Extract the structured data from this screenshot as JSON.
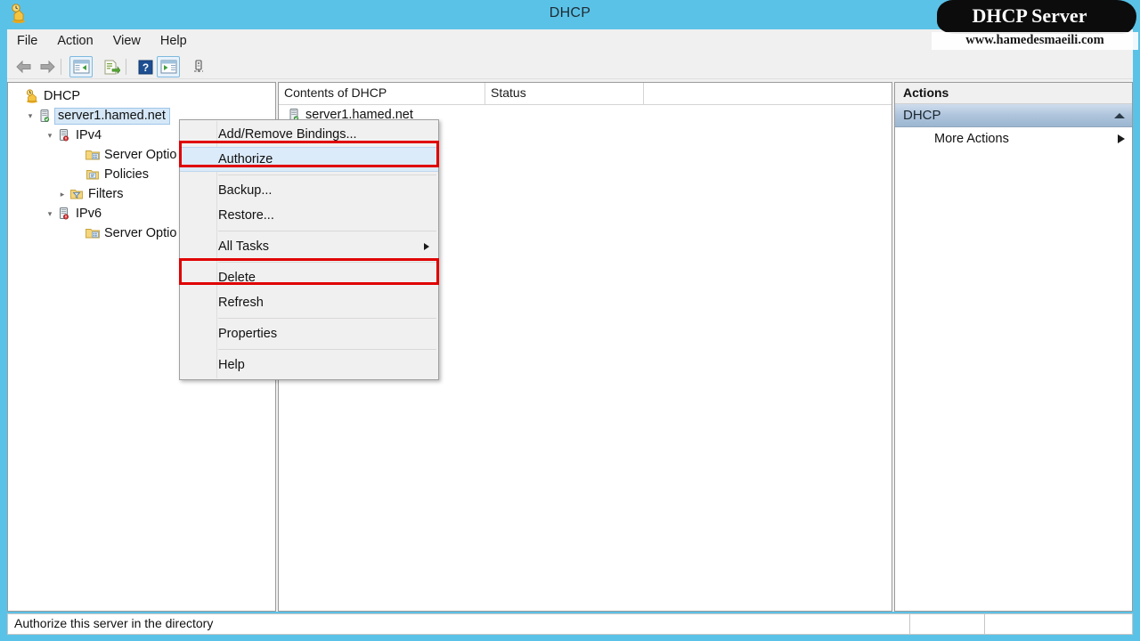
{
  "window": {
    "title": "DHCP",
    "app_icon": "dhcp-server-icon"
  },
  "menubar": {
    "items": [
      {
        "label": "File"
      },
      {
        "label": "Action"
      },
      {
        "label": "View"
      },
      {
        "label": "Help"
      }
    ]
  },
  "toolbar": {
    "buttons": [
      {
        "name": "back-icon"
      },
      {
        "name": "forward-icon"
      },
      {
        "name": "show-hide-console-tree-icon"
      },
      {
        "name": "export-list-icon"
      },
      {
        "name": "help-icon"
      },
      {
        "name": "show-hide-action-pane-icon"
      },
      {
        "name": "refresh-server-icon"
      }
    ]
  },
  "tree": {
    "nodes": [
      {
        "label": "DHCP",
        "icon": "dhcp-root-icon",
        "indent": 0,
        "twisty": "",
        "selected": false
      },
      {
        "label": "server1.hamed.net",
        "icon": "server-icon",
        "indent": 1,
        "twisty": "expanded",
        "selected": true
      },
      {
        "label": "IPv4",
        "icon": "ipv4-icon",
        "indent": 2,
        "twisty": "expanded",
        "selected": false
      },
      {
        "label": "Server Optio",
        "icon": "server-options-folder-icon",
        "indent": 3,
        "twisty": "",
        "selected": false
      },
      {
        "label": "Policies",
        "icon": "policies-folder-icon",
        "indent": 3,
        "twisty": "",
        "selected": false
      },
      {
        "label": "Filters",
        "icon": "filters-folder-icon",
        "indent": 2,
        "twisty": "collapsed",
        "selected": false
      },
      {
        "label": "IPv6",
        "icon": "ipv6-icon",
        "indent": 2,
        "twisty": "expanded",
        "selected": false
      },
      {
        "label": "Server Optio",
        "icon": "server-options-folder-icon",
        "indent": 3,
        "twisty": "",
        "selected": false
      }
    ]
  },
  "list": {
    "columns": [
      {
        "label": "Contents of DHCP"
      },
      {
        "label": "Status"
      },
      {
        "label": ""
      }
    ],
    "rows": [
      {
        "name": "server1.hamed.net",
        "status": "",
        "icon": "server-icon"
      }
    ]
  },
  "actions": {
    "title": "Actions",
    "group_label": "DHCP",
    "group_collapse_icon": "caret-up-icon",
    "items": [
      {
        "label": "More Actions",
        "submenu_icon": "caret-right-icon"
      }
    ]
  },
  "context_menu": {
    "items": [
      {
        "label": "Add/Remove Bindings...",
        "highlight": false,
        "submenu": false,
        "separator_after": false
      },
      {
        "label": "Authorize",
        "highlight": true,
        "submenu": false,
        "separator_after": true
      },
      {
        "label": "Backup...",
        "highlight": false,
        "submenu": false,
        "separator_after": false
      },
      {
        "label": "Restore...",
        "highlight": false,
        "submenu": false,
        "separator_after": true
      },
      {
        "label": "All Tasks",
        "highlight": false,
        "submenu": true,
        "separator_after": true
      },
      {
        "label": "Delete",
        "highlight": false,
        "submenu": false,
        "separator_after": false
      },
      {
        "label": "Refresh",
        "highlight": false,
        "submenu": false,
        "separator_after": true
      },
      {
        "label": "Properties",
        "highlight": false,
        "submenu": false,
        "separator_after": true
      },
      {
        "label": "Help",
        "highlight": false,
        "submenu": false,
        "separator_after": false
      }
    ]
  },
  "annotations": {
    "color": "#e00000",
    "boxes": [
      {
        "target": "authorize-menu-item"
      },
      {
        "target": "refresh-menu-item"
      }
    ]
  },
  "statusbar": {
    "message": "Authorize this server in the directory",
    "cells": [
      "",
      "",
      ""
    ]
  },
  "watermark": {
    "banner_text": "DHCP Server",
    "url": "www.hamedesmaeili.com"
  },
  "colors": {
    "desktop_blue": "#5bc2e7",
    "chrome_gray": "#f0f0f0",
    "selection_blue": "#d6e8f7",
    "annotation_red": "#e00000"
  }
}
